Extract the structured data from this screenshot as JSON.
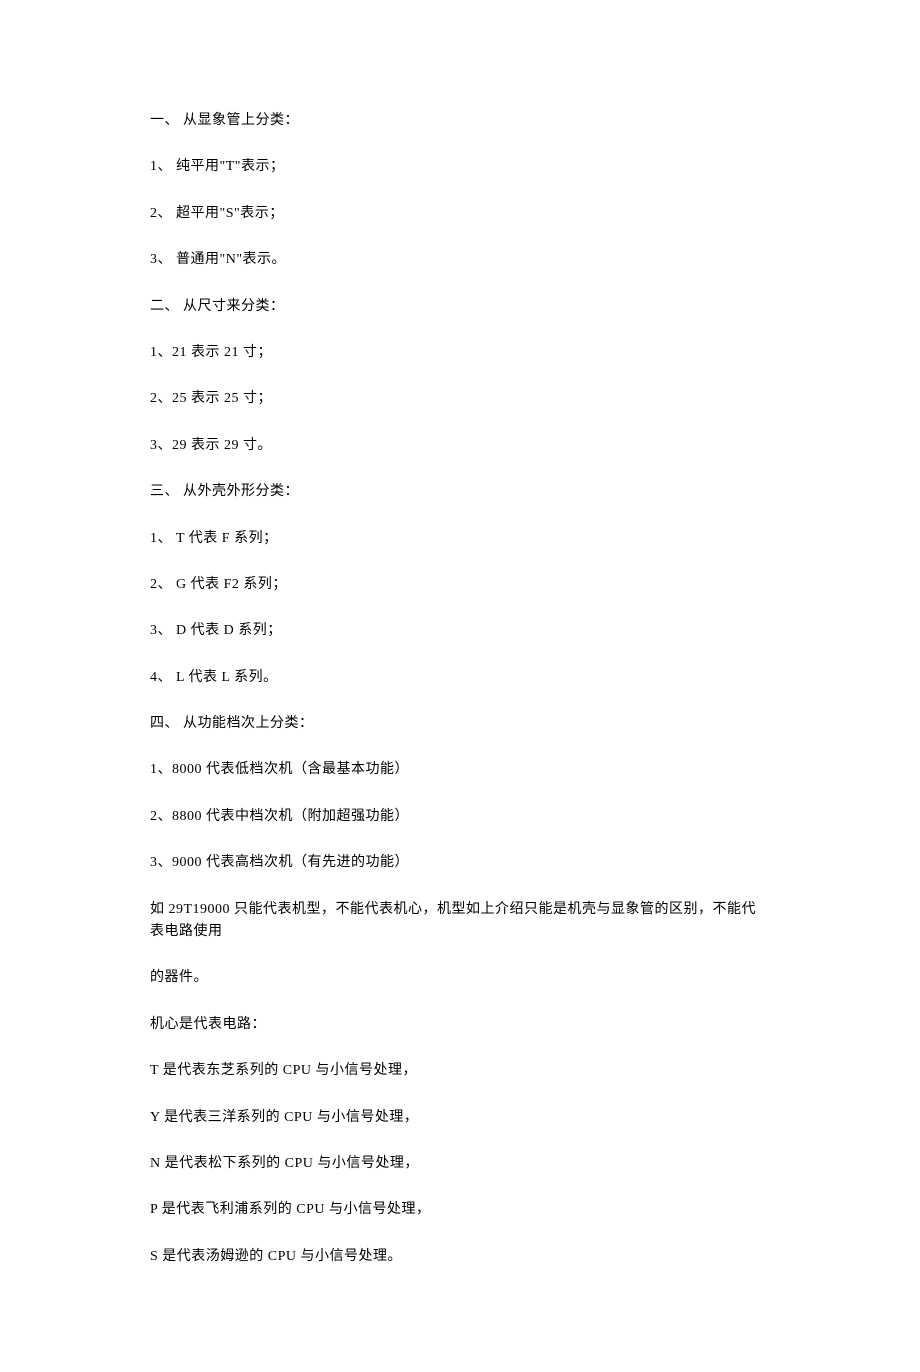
{
  "lines": [
    "一、  从显象管上分类：",
    "1、  纯平用\"T\"表示；",
    "2、  超平用\"S\"表示；",
    "3、  普通用\"N\"表示。",
    "二、  从尺寸来分类：",
    "1、21 表示 21 寸；",
    "2、25 表示 25 寸；",
    "3、29 表示 29 寸。",
    "三、  从外壳外形分类：",
    "1、 T 代表 F 系列；",
    "2、 G 代表 F2 系列；",
    "3、 D 代表 D 系列；",
    "4、 L 代表 L 系列。",
    "四、  从功能档次上分类：",
    "1、8000 代表低档次机（含最基本功能）",
    "2、8800 代表中档次机（附加超强功能）",
    "3、9000 代表高档次机（有先进的功能）",
    "如 29T19000 只能代表机型，不能代表机心，机型如上介绍只能是机壳与显象管的区别，不能代表电路使用",
    "的器件。",
    "   机心是代表电路：",
    "T  是代表东芝系列的 CPU 与小信号处理，",
    "Y  是代表三洋系列的 CPU 与小信号处理，",
    "N  是代表松下系列的 CPU 与小信号处理，",
    "P  是代表飞利浦系列的 CPU 与小信号处理，",
    "S  是代表汤姆逊的 CPU 与小信号处理。"
  ]
}
